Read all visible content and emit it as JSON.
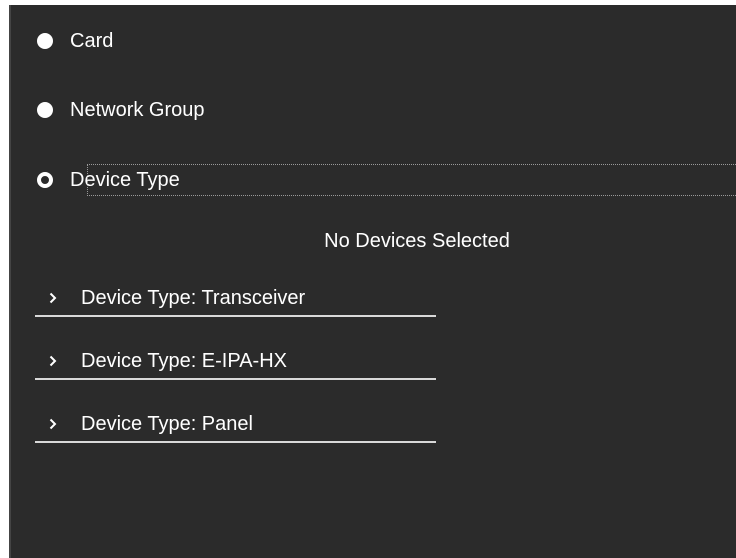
{
  "filter_options": [
    {
      "label": "Card",
      "selected": false
    },
    {
      "label": "Network Group",
      "selected": false
    },
    {
      "label": "Device Type",
      "selected": true
    }
  ],
  "status": {
    "message": "No Devices Selected"
  },
  "device_groups": [
    {
      "label": "Device Type: Transceiver",
      "icon": "chevron-right-icon"
    },
    {
      "label": "Device Type: E-IPA-HX",
      "icon": "chevron-right-icon"
    },
    {
      "label": "Device Type: Panel",
      "icon": "chevron-right-icon"
    }
  ],
  "colors": {
    "background": "#2b2b2b",
    "text": "#ffffff",
    "divider": "#d9d9d9"
  }
}
